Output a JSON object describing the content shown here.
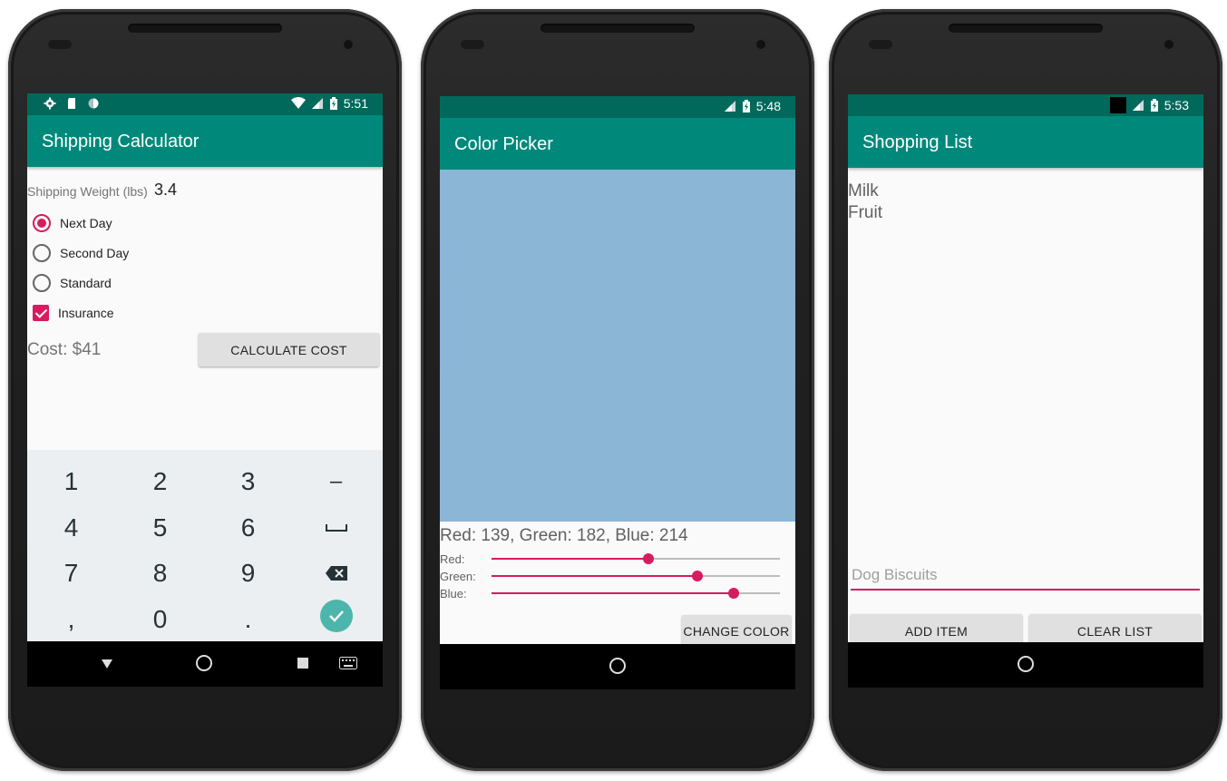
{
  "colors": {
    "primary": "#00897b",
    "primary_dark": "#00695c",
    "accent": "#d81b60",
    "swatch": "#8bb6d6"
  },
  "shipping": {
    "time": "5:51",
    "title": "Shipping Calculator",
    "weight_label": "Shipping Weight (lbs)",
    "weight_value": "3.4",
    "options": [
      "Next Day",
      "Second Day",
      "Standard"
    ],
    "selected_option": "Next Day",
    "insurance_label": "Insurance",
    "insurance_checked": true,
    "cost_text": "Cost: $41",
    "calculate_label": "CALCULATE COST",
    "keypad": {
      "row1": [
        "1",
        "2",
        "3",
        "–"
      ],
      "row2": [
        "4",
        "5",
        "6"
      ],
      "row3": [
        "7",
        "8",
        "9"
      ],
      "row4": [
        ",",
        "0",
        "."
      ],
      "space_icon": "space-icon",
      "backspace_icon": "backspace-icon",
      "done_icon": "done-check-icon"
    }
  },
  "colorpicker": {
    "time": "5:48",
    "title": "Color Picker",
    "rgb_text": "Red: 139, Green: 182, Blue: 214",
    "sliders": [
      {
        "label": "Red:",
        "value": 139,
        "max": 255
      },
      {
        "label": "Green:",
        "value": 182,
        "max": 255
      },
      {
        "label": "Blue:",
        "value": 214,
        "max": 255
      }
    ],
    "change_label": "CHANGE COLOR"
  },
  "shopping": {
    "time": "5:53",
    "title": "Shopping List",
    "items": [
      "Milk",
      "Fruit"
    ],
    "input_value": "Dog Biscuits",
    "add_label": "ADD ITEM",
    "clear_label": "CLEAR LIST"
  }
}
